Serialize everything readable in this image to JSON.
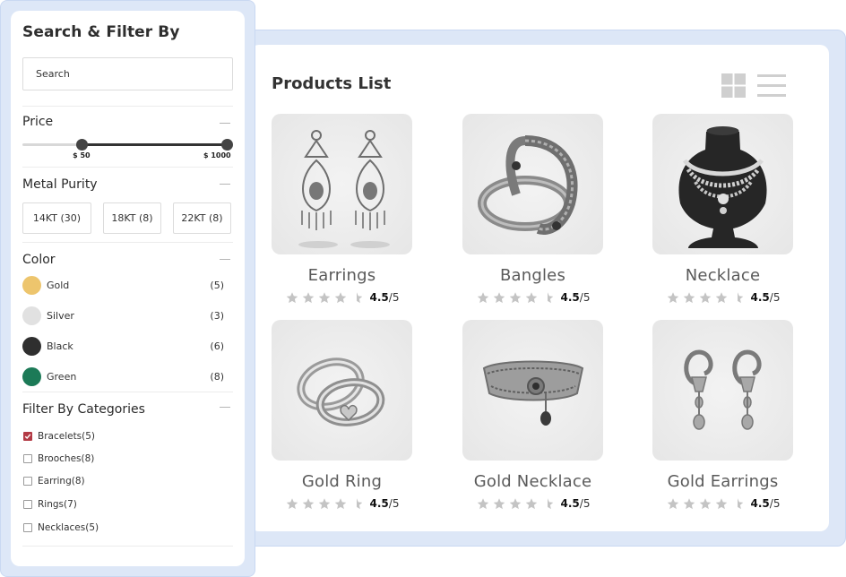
{
  "sidebar": {
    "title": "Search & Filter By",
    "search_placeholder": "Search",
    "price": {
      "title": "Price",
      "min_label": "$ 50",
      "max_label": "$ 1000",
      "range_low_fraction": 0.29,
      "range_high_fraction": 1.0
    },
    "purity": {
      "title": "Metal Purity",
      "options": [
        "14KT (30)",
        "18KT (8)",
        "22KT (8)"
      ]
    },
    "color": {
      "title": "Color",
      "items": [
        {
          "name": "Gold",
          "count": "(5)",
          "swatch": "#edc56d"
        },
        {
          "name": "Silver",
          "count": "(3)",
          "swatch": "#e1e1e1"
        },
        {
          "name": "Black",
          "count": "(6)",
          "swatch": "#2f2f2f"
        },
        {
          "name": "Green",
          "count": "(8)",
          "swatch": "#1c7a57"
        }
      ]
    },
    "categories": {
      "title": "Filter By Categories",
      "items": [
        {
          "label": "Bracelets(5)",
          "checked": true
        },
        {
          "label": "Brooches(8)",
          "checked": false
        },
        {
          "label": "Earring(8)",
          "checked": false
        },
        {
          "label": "Rings(7)",
          "checked": false
        },
        {
          "label": "Necklaces(5)",
          "checked": false
        }
      ]
    }
  },
  "products": {
    "title": "Products List",
    "view_icons": [
      "grid-view-icon",
      "list-view-icon"
    ],
    "items": [
      {
        "name": "Earrings",
        "rating_value": "4.5",
        "rating_scale": "/5",
        "icon": "earrings-icon"
      },
      {
        "name": "Bangles",
        "rating_value": "4.5",
        "rating_scale": "/5",
        "icon": "bangles-icon"
      },
      {
        "name": "Necklace",
        "rating_value": "4.5",
        "rating_scale": "/5",
        "icon": "necklace-icon"
      },
      {
        "name": "Gold Ring",
        "rating_value": "4.5",
        "rating_scale": "/5",
        "icon": "ring-icon"
      },
      {
        "name": "Gold Necklace",
        "rating_value": "4.5",
        "rating_scale": "/5",
        "icon": "choker-icon"
      },
      {
        "name": "Gold Earrings",
        "rating_value": "4.5",
        "rating_scale": "/5",
        "icon": "drop-earrings-icon"
      }
    ]
  },
  "colors": {
    "accent_checkbox": "#b33a45",
    "frame": "#dde7f7",
    "star": "#c4c4c4"
  }
}
